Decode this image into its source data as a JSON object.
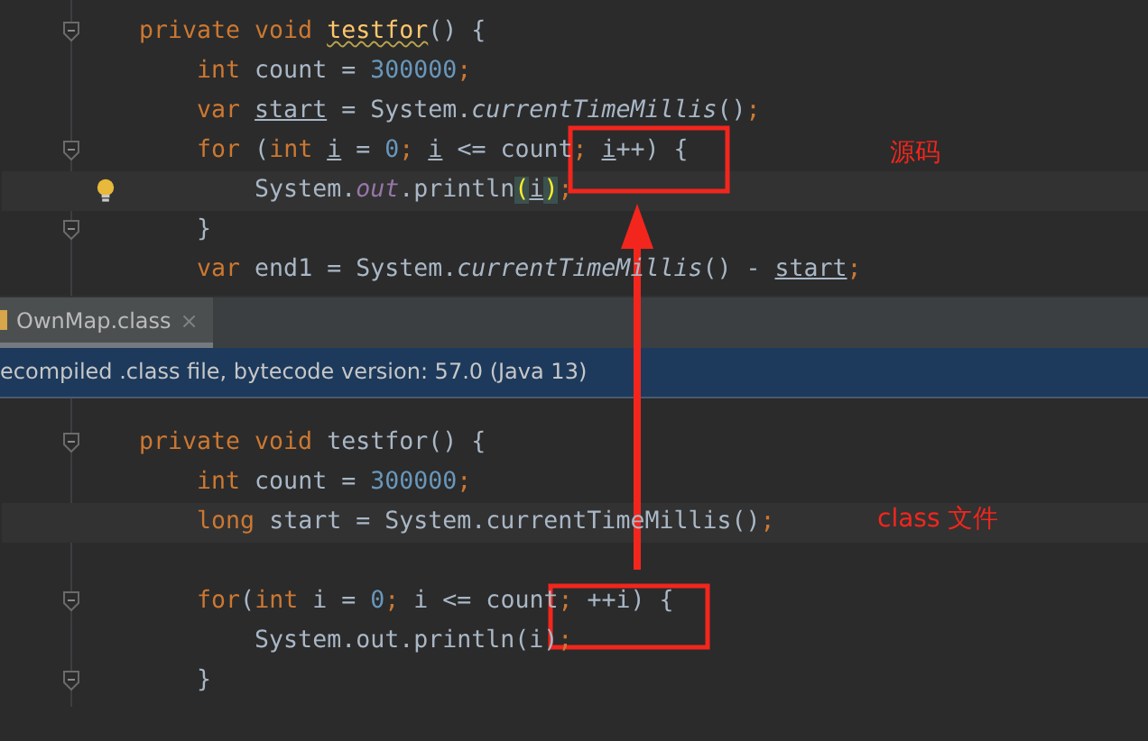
{
  "source_editor": {
    "lines": [
      {
        "current": false,
        "fold": true,
        "bulb": false,
        "tokens": [
          {
            "text": "private void ",
            "kind": "kw"
          },
          {
            "text": "testfor",
            "kind": "warn"
          },
          {
            "text": "() {",
            "kind": "plain"
          }
        ]
      },
      {
        "current": false,
        "fold": false,
        "bulb": false,
        "tokens": [
          {
            "text": "    int ",
            "kind": "kw"
          },
          {
            "text": "count = ",
            "kind": "plain"
          },
          {
            "text": "300000",
            "kind": "num"
          },
          {
            "text": ";",
            "kind": "punct"
          }
        ]
      },
      {
        "current": false,
        "fold": false,
        "bulb": false,
        "tokens": [
          {
            "text": "    var ",
            "kind": "kw"
          },
          {
            "text": "start",
            "kind": "ref"
          },
          {
            "text": " = System.",
            "kind": "plain"
          },
          {
            "text": "currentTimeMillis",
            "kind": "call"
          },
          {
            "text": "()",
            "kind": "plain"
          },
          {
            "text": ";",
            "kind": "punct"
          }
        ]
      },
      {
        "current": false,
        "fold": true,
        "bulb": false,
        "tokens": [
          {
            "text": "    for ",
            "kind": "kw"
          },
          {
            "text": "(",
            "kind": "plain"
          },
          {
            "text": "int ",
            "kind": "kw"
          },
          {
            "text": "i",
            "kind": "ref"
          },
          {
            "text": " = ",
            "kind": "plain"
          },
          {
            "text": "0",
            "kind": "num"
          },
          {
            "text": "; ",
            "kind": "punct"
          },
          {
            "text": "i",
            "kind": "ref"
          },
          {
            "text": " <= count",
            "kind": "plain"
          },
          {
            "text": "; ",
            "kind": "punct"
          },
          {
            "text": "i",
            "kind": "ref"
          },
          {
            "text": "++) {",
            "kind": "plain"
          }
        ]
      },
      {
        "current": true,
        "fold": false,
        "bulb": true,
        "tokens": [
          {
            "text": "        System.",
            "kind": "plain"
          },
          {
            "text": "out",
            "kind": "field"
          },
          {
            "text": ".println",
            "kind": "plain"
          },
          {
            "text": "(",
            "kind": "match"
          },
          {
            "text": "i",
            "kind": "ref"
          },
          {
            "text": ")",
            "kind": "match"
          },
          {
            "text": ";",
            "kind": "punct"
          }
        ]
      },
      {
        "current": false,
        "fold": true,
        "bulb": false,
        "tokens": [
          {
            "text": "    }",
            "kind": "plain"
          }
        ]
      },
      {
        "current": false,
        "fold": false,
        "bulb": false,
        "tokens": [
          {
            "text": "    var ",
            "kind": "kw"
          },
          {
            "text": "end1 = System.",
            "kind": "plain"
          },
          {
            "text": "currentTimeMillis",
            "kind": "call"
          },
          {
            "text": "() - ",
            "kind": "plain"
          },
          {
            "text": "start",
            "kind": "ref"
          },
          {
            "text": ";",
            "kind": "punct"
          }
        ]
      }
    ]
  },
  "tabs": [
    {
      "label": "OwnMap.class",
      "close": "×",
      "selected": true
    }
  ],
  "banner": {
    "text": "ecompiled .class file, bytecode version: 57.0 (Java 13)"
  },
  "class_editor": {
    "lines": [
      {
        "current": false,
        "fold": true,
        "bulb": false,
        "tokens": [
          {
            "text": "private void ",
            "kind": "kw"
          },
          {
            "text": "testfor() {",
            "kind": "plain"
          }
        ]
      },
      {
        "current": false,
        "fold": false,
        "bulb": false,
        "tokens": [
          {
            "text": "    int ",
            "kind": "kw"
          },
          {
            "text": "count = ",
            "kind": "plain"
          },
          {
            "text": "300000",
            "kind": "num"
          },
          {
            "text": ";",
            "kind": "punct"
          }
        ]
      },
      {
        "current": true,
        "fold": false,
        "bulb": false,
        "tokens": [
          {
            "text": "    long ",
            "kind": "kw"
          },
          {
            "text": "start = System.currentTimeMillis()",
            "kind": "plain"
          },
          {
            "text": ";",
            "kind": "punct"
          }
        ]
      },
      {
        "current": false,
        "fold": false,
        "bulb": false
      },
      {
        "current": false,
        "fold": true,
        "bulb": false,
        "tokens": [
          {
            "text": "    for",
            "kind": "kw"
          },
          {
            "text": "(",
            "kind": "plain"
          },
          {
            "text": "int ",
            "kind": "kw"
          },
          {
            "text": "i = ",
            "kind": "plain"
          },
          {
            "text": "0",
            "kind": "num"
          },
          {
            "text": "; ",
            "kind": "punct"
          },
          {
            "text": "i <= count",
            "kind": "plain"
          },
          {
            "text": "; ",
            "kind": "punct"
          },
          {
            "text": "++i) {",
            "kind": "plain"
          }
        ]
      },
      {
        "current": false,
        "fold": false,
        "bulb": false,
        "tokens": [
          {
            "text": "        System.out.println(i)",
            "kind": "plain"
          },
          {
            "text": ";",
            "kind": "punct"
          }
        ]
      },
      {
        "current": false,
        "fold": true,
        "bulb": false,
        "tokens": [
          {
            "text": "    }",
            "kind": "plain"
          }
        ]
      }
    ]
  },
  "annotations": [
    {
      "text": "源码"
    },
    {
      "text": "class 文件"
    }
  ]
}
